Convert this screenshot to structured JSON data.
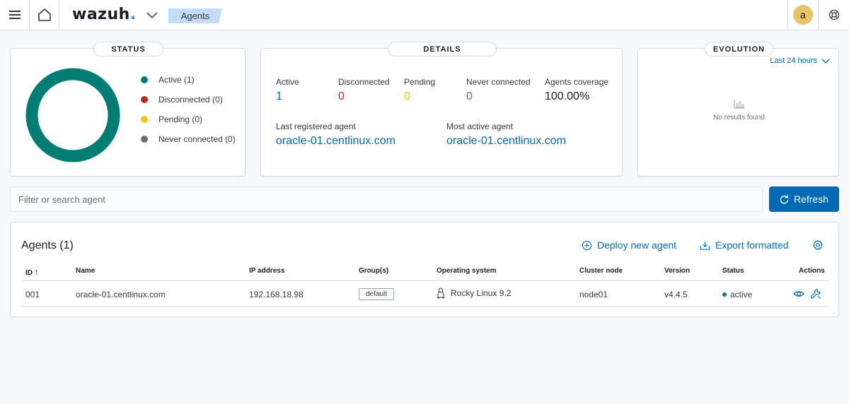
{
  "app": {
    "logo_text": "wazuh",
    "logo_dot": ".",
    "breadcrumb": "Agents",
    "user_initial": "a"
  },
  "colors": {
    "active": "#017d73",
    "disconnected": "#bd271e",
    "pending": "#f5a700",
    "never_connected": "#69707d",
    "link": "#006bb4",
    "primary_button": "#006bb4"
  },
  "icons": {
    "menu": "hamburger-icon",
    "home": "home-icon",
    "app_switch": "chevron-down-icon",
    "help": "help-icon",
    "refresh": "refresh-icon",
    "deploy": "plus-circle-icon",
    "export": "export-icon",
    "settings": "gear-icon",
    "view": "eye-icon",
    "config": "wrench-icon",
    "os": "linux-icon",
    "empty": "chart-icon"
  },
  "status": {
    "title": "STATUS",
    "legend": [
      {
        "label": "Active (1)",
        "key": "active"
      },
      {
        "label": "Disconnected (0)",
        "key": "disconnected"
      },
      {
        "label": "Pending (0)",
        "key": "pending"
      },
      {
        "label": "Never connected (0)",
        "key": "never_connected"
      }
    ]
  },
  "details": {
    "title": "DETAILS",
    "stats": [
      {
        "label": "Active",
        "value": "1"
      },
      {
        "label": "Disconnected",
        "value": "0"
      },
      {
        "label": "Pending",
        "value": "0"
      },
      {
        "label": "Never connected",
        "value": "0"
      },
      {
        "label": "Agents coverage",
        "value": "100.00%"
      }
    ],
    "last_registered_label": "Last registered agent",
    "last_registered_value": "oracle-01.centlinux.com",
    "most_active_label": "Most active agent",
    "most_active_value": "oracle-01.centlinux.com"
  },
  "evolution": {
    "title": "EVOLUTION",
    "range": "Last 24 hours",
    "empty_message": "No results found"
  },
  "search": {
    "placeholder": "Filter or search agent",
    "value": ""
  },
  "refresh_label": "Refresh",
  "agents": {
    "title": "Agents (1)",
    "deploy_label": "Deploy new agent",
    "export_label": "Export formatted",
    "columns": [
      "ID",
      "Name",
      "IP address",
      "Group(s)",
      "Operating system",
      "Cluster node",
      "Version",
      "Status",
      "Actions"
    ],
    "sort_indicator": "↑",
    "rows": [
      {
        "id": "001",
        "name": "oracle-01.centlinux.com",
        "ip": "192.168.18.98",
        "group": "default",
        "os": "Rocky Linux 9.2",
        "node": "node01",
        "version": "v4.4.5",
        "status": "active"
      }
    ]
  }
}
